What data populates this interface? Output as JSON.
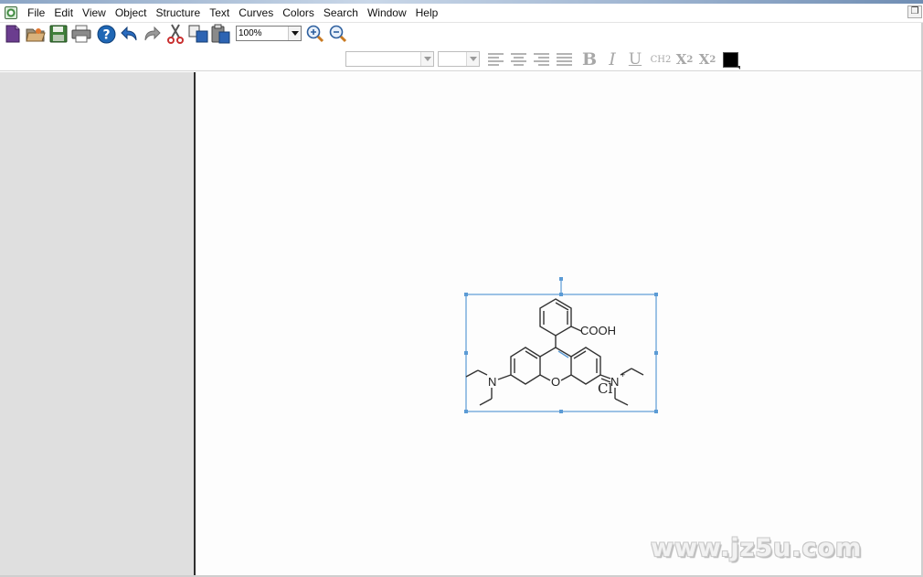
{
  "menubar": {
    "items": [
      "File",
      "Edit",
      "View",
      "Object",
      "Structure",
      "Text",
      "Curves",
      "Colors",
      "Search",
      "Window",
      "Help"
    ]
  },
  "toolbar": {
    "icons": [
      "new-document-icon",
      "open-icon",
      "save-icon",
      "print-icon",
      "help-icon",
      "undo-icon",
      "redo-icon",
      "cut-icon",
      "copy-icon",
      "paste-icon",
      "zoom-in-icon",
      "zoom-out-icon"
    ],
    "zoom_value": "100%"
  },
  "format_toolbar": {
    "chem_label": "CH2",
    "subscript_base": "X",
    "subscript_digit": "2",
    "superscript_base": "X",
    "superscript_digit": "2",
    "bold_label": "B",
    "italic_label": "I",
    "underline_label": "U",
    "text_color": "#000000"
  },
  "molecule": {
    "carboxyl_label": "COOH",
    "left_amine_label": "N",
    "right_amine_label": "N",
    "ring_oxygen_label": "O",
    "counter_ion_label": "Cl",
    "charge_label": "+",
    "selection_color": "#5b9bd5"
  },
  "watermark": {
    "text": "www.jz5u.com"
  }
}
